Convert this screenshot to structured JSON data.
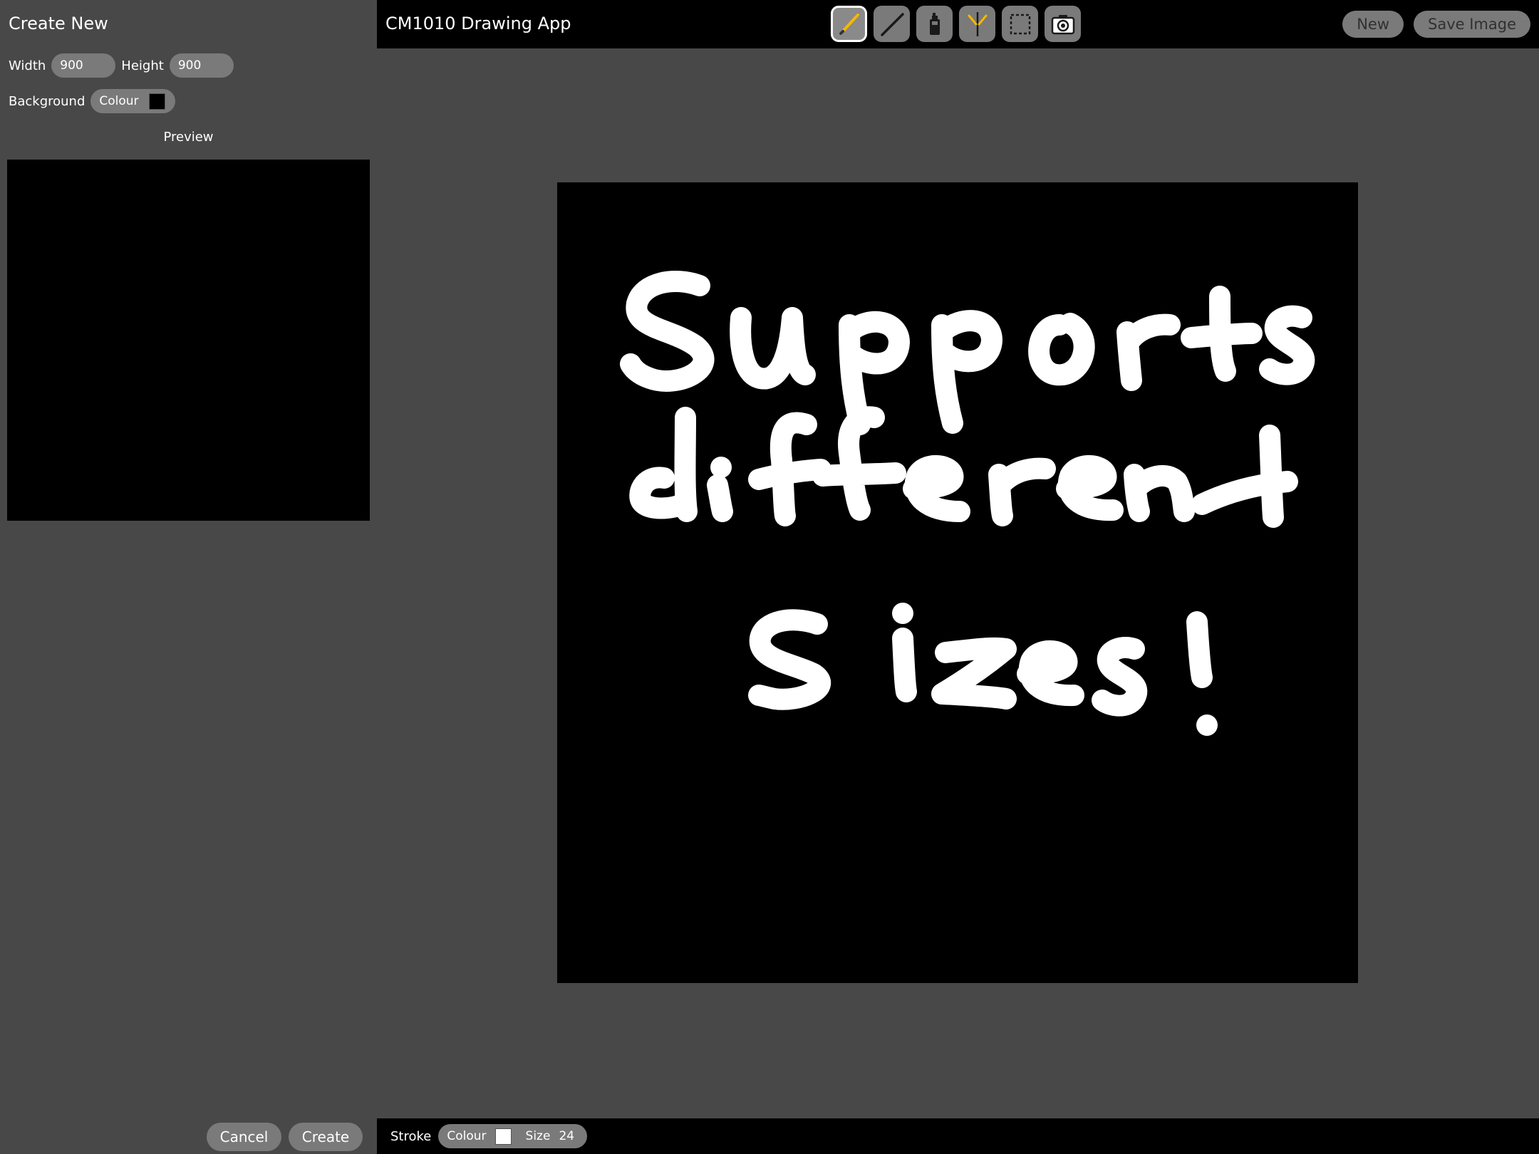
{
  "sidebar": {
    "title": "Create New",
    "width_label": "Width",
    "width_value": "900",
    "height_label": "Height",
    "height_value": "900",
    "background_label": "Background",
    "colour_label": "Colour",
    "background_colour": "#000000",
    "preview_label": "Preview",
    "cancel_label": "Cancel",
    "create_label": "Create"
  },
  "header": {
    "title": "CM1010 Drawing App",
    "tools": [
      {
        "name": "pencil-icon",
        "active": true
      },
      {
        "name": "line-icon",
        "active": false
      },
      {
        "name": "spraycan-icon",
        "active": false
      },
      {
        "name": "mirror-draw-icon",
        "active": false
      },
      {
        "name": "selection-icon",
        "active": false
      },
      {
        "name": "camera-icon",
        "active": false
      }
    ],
    "new_label": "New",
    "save_label": "Save Image"
  },
  "canvas": {
    "background": "#000000",
    "drawn_text": [
      "Supports",
      "different",
      "Sizes!"
    ],
    "ink_colour": "#ffffff"
  },
  "footer": {
    "stroke_label": "Stroke",
    "colour_label": "Colour",
    "stroke_colour": "#ffffff",
    "size_label": "Size",
    "size_value": "24"
  },
  "colors": {
    "panel_bg": "#484848",
    "bar_bg": "#000000",
    "pill_bg": "#7a7a7a",
    "accent": "#f5b800"
  }
}
